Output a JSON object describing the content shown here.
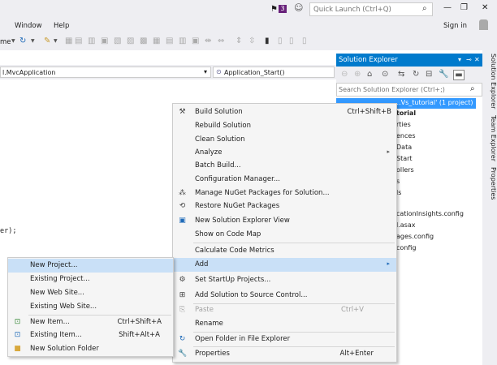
{
  "title_bar": {
    "notification_count": "3",
    "quick_launch_placeholder": "Quick Launch (Ctrl+Q)"
  },
  "menu_bar": {
    "items": [
      "Window",
      "Help"
    ],
    "partial_item": "me",
    "sign_in": "Sign in"
  },
  "navigation_bar": {
    "type_dropdown": "l.MvcApplication",
    "member_dropdown": "Application_Start()"
  },
  "code_editor": {
    "visible_line": "er);"
  },
  "solution_explorer": {
    "title": "Solution Explorer",
    "search_placeholder": "Search Solution Explorer (Ctrl+;)",
    "selected_item": "...Vs_tutorial' (1 project)",
    "tree_items": [
      "torial",
      "rties",
      "ences",
      "Data",
      "Start",
      "ollers",
      "s",
      "ls",
      "",
      "",
      "cationInsights.config",
      "l.asax",
      "ages.config",
      "config"
    ]
  },
  "side_tabs": [
    "Solution Explorer",
    "Team Explorer",
    "Properties"
  ],
  "context_menu": {
    "items": [
      {
        "icon": "build-icon",
        "label": "Build Solution",
        "shortcut": "Ctrl+Shift+B"
      },
      {
        "label": "Rebuild Solution"
      },
      {
        "label": "Clean Solution"
      },
      {
        "label": "Analyze",
        "submenu": true
      },
      {
        "label": "Batch Build..."
      },
      {
        "label": "Configuration Manager..."
      },
      {
        "icon": "nuget-icon",
        "label": "Manage NuGet Packages for Solution..."
      },
      {
        "icon": "restore-icon",
        "label": "Restore NuGet Packages"
      },
      {
        "icon": "new-view-icon",
        "label": "New Solution Explorer View"
      },
      {
        "label": "Show on Code Map"
      },
      {
        "label": "Calculate Code Metrics"
      },
      {
        "label": "Add",
        "submenu": true,
        "highlighted": true
      },
      {
        "icon": "gear-icon",
        "label": "Set StartUp Projects..."
      },
      {
        "icon": "source-control-icon",
        "label": "Add Solution to Source Control..."
      },
      {
        "label": "Paste",
        "shortcut": "Ctrl+V",
        "disabled": true
      },
      {
        "label": "Rename"
      },
      {
        "icon": "refresh-icon",
        "label": "Open Folder in File Explorer"
      },
      {
        "icon": "wrench-icon",
        "label": "Properties",
        "shortcut": "Alt+Enter"
      }
    ]
  },
  "add_submenu": {
    "items": [
      {
        "label": "New Project...",
        "highlighted": true
      },
      {
        "label": "Existing Project..."
      },
      {
        "label": "New Web Site..."
      },
      {
        "label": "Existing Web Site..."
      },
      {
        "icon": "new-item-icon",
        "label": "New Item...",
        "shortcut": "Ctrl+Shift+A"
      },
      {
        "icon": "existing-item-icon",
        "label": "Existing Item...",
        "shortcut": "Shift+Alt+A"
      },
      {
        "icon": "folder-icon",
        "label": "New Solution Folder"
      }
    ]
  },
  "colors": {
    "accent": "#007acc",
    "selection": "#3399ff",
    "menu_highlight": "#c9e0f7",
    "chrome": "#eeeef2",
    "badge": "#68217a"
  }
}
